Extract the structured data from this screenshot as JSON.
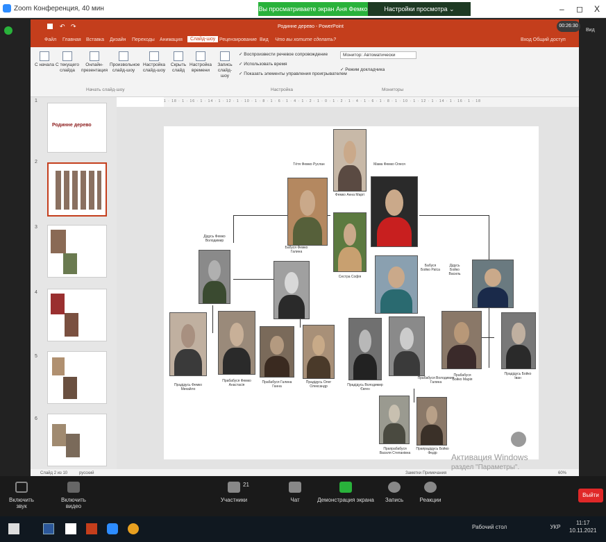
{
  "zoom_window": {
    "title": "Zoom Конференция, 40 мин",
    "share_banner": "Вы просматриваете экран Аня Фемко",
    "view_options": "Настройки просмотра ⌄",
    "minimize": "–",
    "maximize": "◻",
    "close": "X",
    "timer": "00:26:30",
    "side_label": "Вид"
  },
  "ppt": {
    "title": "Родинне дерево - PowerPoint",
    "share_label": "Вход  Общий доступ",
    "menus": [
      "Файл",
      "Главная",
      "Вставка",
      "Дизайн",
      "Переходы",
      "Анимация",
      "Слайд-шоу",
      "Рецензирование",
      "Вид",
      "Что вы хотите сделать?"
    ],
    "active_menu": "Слайд-шоу",
    "ribbon": {
      "buttons": [
        "С начала",
        "С текущего слайда",
        "Онлайн-презентация",
        "Произвольное слайд-шоу",
        "Настройка слайд-шоу",
        "Скрыть слайд",
        "Настройка времени",
        "Запись слайд-шоу"
      ],
      "checks": [
        "Воспроизвести речевое сопровождение",
        "Использовать время",
        "Показать элементы управления проигрывателем"
      ],
      "monitor_label": "Монитор: Автоматически",
      "presenter_view": "Режим докладчика",
      "group1": "Начать слайд-шоу",
      "group2": "Настройка",
      "group3": "Мониторы"
    },
    "thumb_numbers": [
      "1",
      "2",
      "3",
      "4",
      "5",
      "6"
    ],
    "thumb1_title": "Родинне дерево",
    "status_left": "Слайд 2 из 10",
    "status_lang": "русский",
    "status_right": "Заметки  Примечания",
    "zoom_pct": "60%"
  },
  "slide": {
    "labels": {
      "sister_top": "Тётя Фемко Руслан",
      "mother_top": "Мама Фемко Олеся",
      "me": "Фемко Анна Маргі",
      "sister_sofia": "Сестра Софія",
      "grandpa_left": "Дідусь Фемко Володимир",
      "grandma_left": "Бабуся Фемко Галина",
      "grandma_right": "Бабуся Бойко Раїса",
      "grandpa_right": "Дідусь Бойко Василь",
      "ggp1": "Прадідусь Фемко Михайло",
      "ggp2": "Прабабуся Фемко Анастасія",
      "ggp3": "Прабабуся Галина Ганна",
      "ggp4": "Прадідусь Олег Олександр",
      "ggp5": "Прадідусь Володимир Євген",
      "ggp6": "Прабабуся Володимир Галина",
      "ggp7": "Прабабуся Бойко Марія",
      "ggp8": "Прадідусь Бойко Іван",
      "gggp1": "Прапрабабуся Василя Степанівна",
      "gggp2": "Прапрадідусь Бойко Федір"
    }
  },
  "activation": {
    "line1": "Активация Windows",
    "line2": "раздел \"Параметры\"."
  },
  "zoom_toolbar": {
    "mute": "Включить звук",
    "video": "Включить видео",
    "participants": "Участники",
    "participants_count": "21",
    "chat": "Чат",
    "share": "Демонстрация экрана",
    "record": "Запись",
    "reactions": "Реакции",
    "exit": "Выйти"
  },
  "taskbar": {
    "desktop": "Рабочий стол",
    "lang": "УКР",
    "time": "11:17",
    "date": "10.11.2021"
  },
  "colors": {
    "ppt_accent": "#c43e1c",
    "zoom_green": "#29b23b",
    "exit_red": "#e02828"
  }
}
